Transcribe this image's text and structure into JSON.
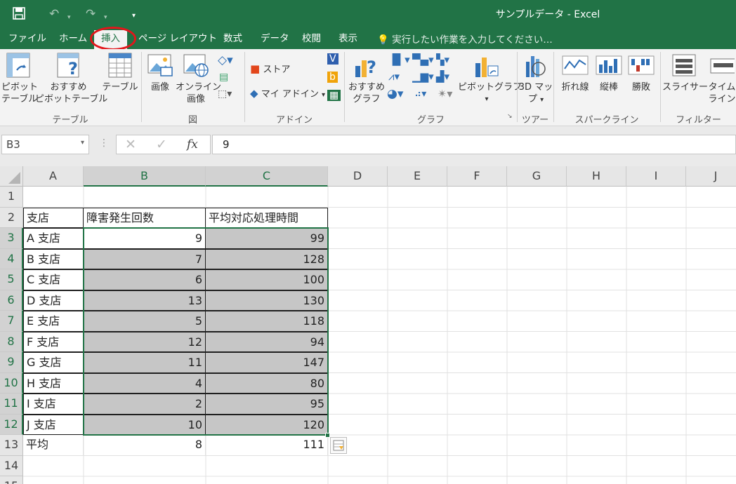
{
  "window": {
    "title": "サンプルデータ - Excel"
  },
  "qat": {
    "save_icon": "save-icon",
    "undo_icon": "undo-icon",
    "redo_icon": "redo-icon",
    "customize_icon": "customize-qat-icon"
  },
  "tabs": [
    "ファイル",
    "ホーム",
    "挿入",
    "ページ レイアウト",
    "数式",
    "データ",
    "校閲",
    "表示"
  ],
  "active_tab": "挿入",
  "tell_me": "実行したい作業を入力してください…",
  "ribbon": {
    "pivot_table": [
      "ピボット",
      "テーブル"
    ],
    "recommended_pivot": [
      "おすすめ",
      "ピボットテーブル"
    ],
    "table": "テーブル",
    "picture": "画像",
    "online_picture": [
      "オンライン",
      "画像"
    ],
    "store": "ストア",
    "my_addins": "マイ アドイン",
    "recommended_chart": [
      "おすすめ",
      "グラフ"
    ],
    "pivot_chart": "ピボットグラフ",
    "map3d": [
      "3D マッ",
      "プ"
    ],
    "sparkline_line": "折れ線",
    "sparkline_column": "縦棒",
    "sparkline_winloss": "勝敗",
    "slicer": "スライサー",
    "timeline": [
      "タイム",
      "ライン"
    ],
    "groups": {
      "table": "テーブル",
      "illustrations": "図",
      "addins": "アドイン",
      "charts": "グラフ",
      "tours": "ツアー",
      "sparklines": "スパークライン",
      "filters": "フィルター"
    }
  },
  "formula_bar": {
    "name_box": "B3",
    "value": "9",
    "fx": "fx"
  },
  "columns": [
    "A",
    "B",
    "C",
    "D",
    "E",
    "F",
    "G",
    "H",
    "I",
    "J"
  ],
  "rows": [
    "1",
    "2",
    "3",
    "4",
    "5",
    "6",
    "7",
    "8",
    "9",
    "10",
    "11",
    "12",
    "13",
    "14",
    "15"
  ],
  "sheet": {
    "headers": [
      "支店",
      "障害発生回数",
      "平均対応処理時間"
    ],
    "data": [
      [
        "A 支店",
        "9",
        "99"
      ],
      [
        "B 支店",
        "7",
        "128"
      ],
      [
        "C 支店",
        "6",
        "100"
      ],
      [
        "D 支店",
        "13",
        "130"
      ],
      [
        "E 支店",
        "5",
        "118"
      ],
      [
        "F 支店",
        "12",
        "94"
      ],
      [
        "G 支店",
        "11",
        "147"
      ],
      [
        "H 支店",
        "4",
        "80"
      ],
      [
        "I 支店",
        "2",
        "95"
      ],
      [
        "J 支店",
        "10",
        "120"
      ]
    ],
    "average": [
      "平均",
      "8",
      "111"
    ]
  },
  "colors": {
    "excel_green": "#217346",
    "highlight_red": "#e2161b",
    "selection_gray": "#c6c6c6"
  }
}
